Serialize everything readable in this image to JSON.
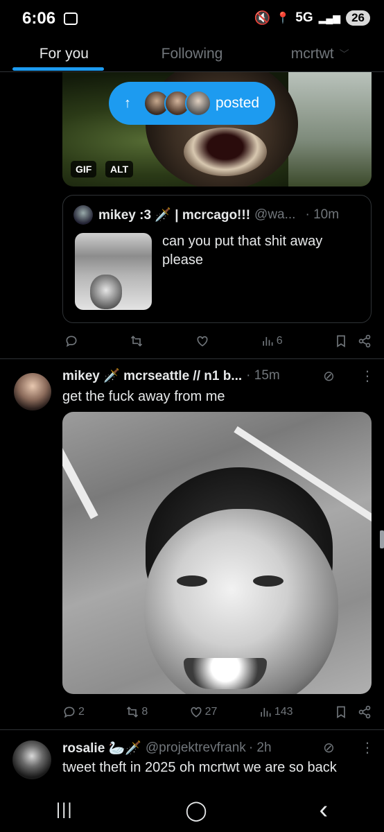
{
  "status_bar": {
    "time": "6:06",
    "network": "5G",
    "battery": "26"
  },
  "tabs": [
    {
      "label": "For you"
    },
    {
      "label": "Following"
    },
    {
      "label": "mcrtwt"
    }
  ],
  "media_top": {
    "tags": [
      "GIF",
      "ALT"
    ]
  },
  "posted_pill": {
    "label": "posted"
  },
  "quote": {
    "name": "mikey :3 🗡️ | mcrcago!!!",
    "handle": "@wa...",
    "time": "· 10m",
    "text": "can you put that shit away please"
  },
  "actions1": {
    "reply": "",
    "retweet": "",
    "like": "",
    "views": "6"
  },
  "tweet1": {
    "name": "mikey 🗡️ mcrseattle // n1 b...",
    "time": "· 15m",
    "text": "get the fuck away from me",
    "replies": "2",
    "retweets": "8",
    "likes": "27",
    "views": "143"
  },
  "tweet2": {
    "name": "rosalie 🦢🗡️",
    "handle": "@projektrevfrank",
    "time": "· 2h",
    "text": "tweet theft in 2025 oh mcrtwt we are so back"
  },
  "nav": {
    "recents": "|||",
    "home": "◯",
    "back": "‹"
  },
  "colors": {
    "accent": "#1d9bf0",
    "background": "#000000",
    "muted": "#71767b"
  }
}
